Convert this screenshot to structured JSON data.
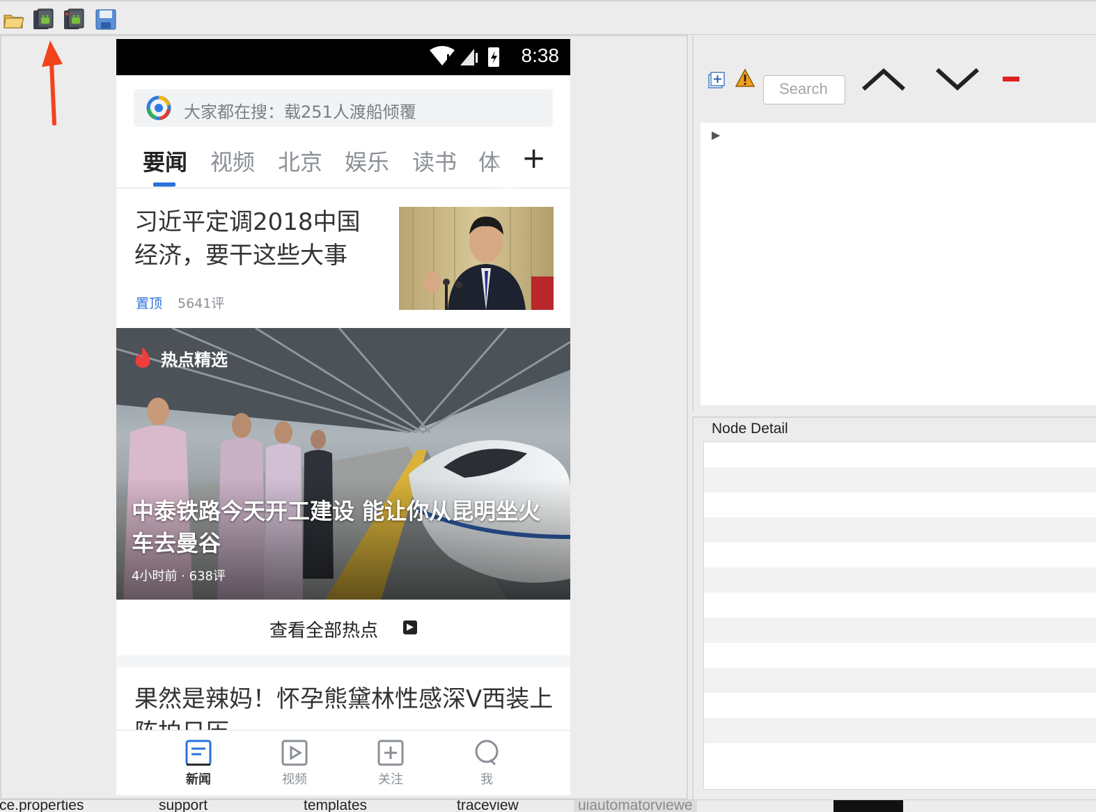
{
  "toolbar": {
    "icons": [
      "open-folder-icon",
      "device-screenshot-icon",
      "device-screenshot-compressed-icon",
      "save-icon"
    ]
  },
  "phone": {
    "status": {
      "time": "8:38"
    },
    "search": {
      "text": "大家都在搜：载251人渡船倾覆"
    },
    "tabs": [
      "要闻",
      "视频",
      "北京",
      "娱乐",
      "读书",
      "体"
    ],
    "news1": {
      "title": "习近平定调2018中国经济，要干这些大事",
      "pin": "置顶",
      "comments": "5641评"
    },
    "hot": {
      "badge": "热点精选",
      "title_line1": "中泰铁路今天开工建设 能让你从昆明坐火",
      "title_line2": "车去曼谷",
      "meta": "4小时前 · 638评"
    },
    "view_all": "查看全部热点",
    "news2": {
      "title": "果然是辣妈！怀孕熊黛林性感深V西装上阵拍日历"
    },
    "nav": [
      {
        "label": "新闻",
        "icon": "news-icon"
      },
      {
        "label": "视频",
        "icon": "video-icon"
      },
      {
        "label": "关注",
        "icon": "follow-icon"
      },
      {
        "label": "我",
        "icon": "profile-icon"
      }
    ]
  },
  "hierarchy": {
    "search_placeholder": "Search"
  },
  "node_detail": {
    "label": "Node Detail"
  },
  "bottom_tabs": [
    "rce.properties",
    "support",
    "templates",
    "traceview",
    "uiautomatorviewe"
  ],
  "colors": {
    "accent_blue": "#2a72d8",
    "warning_orange": "#f0a020",
    "minus_red": "#e02020",
    "arrow_red": "#f2431c"
  }
}
